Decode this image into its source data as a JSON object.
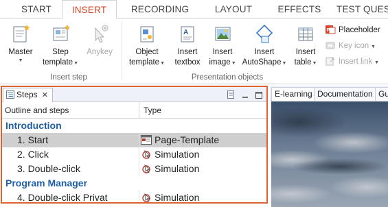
{
  "tabs": [
    {
      "label": "START",
      "active": false
    },
    {
      "label": "INSERT",
      "active": true
    },
    {
      "label": "RECORDING",
      "active": false
    },
    {
      "label": "LAYOUT",
      "active": false
    },
    {
      "label": "EFFECTS",
      "active": false
    },
    {
      "label": "TEST QUES",
      "active": false
    }
  ],
  "ribbon": {
    "insert_step_group": {
      "label": "Insert step",
      "master": {
        "line1": "Master",
        "line2": ""
      },
      "step_template": {
        "line1": "Step",
        "line2": "template"
      },
      "anykey": {
        "line1": "Anykey"
      }
    },
    "presentation_group": {
      "label": "Presentation objects",
      "object_template": {
        "line1": "Object",
        "line2": "template"
      },
      "insert_textbox": {
        "line1": "Insert",
        "line2": "textbox"
      },
      "insert_image": {
        "line1": "Insert",
        "line2": "image"
      },
      "insert_autoshape": {
        "line1": "Insert",
        "line2": "AutoShape"
      },
      "insert_table": {
        "line1": "Insert",
        "line2": "table"
      },
      "placeholder": "Placeholder",
      "key_icon": "Key icon",
      "insert_link": "Insert link"
    }
  },
  "steps_panel": {
    "tab_label": "Steps",
    "columns": {
      "outline": "Outline and steps",
      "type": "Type"
    },
    "rows": [
      {
        "kind": "section",
        "name": "Introduction",
        "type": ""
      },
      {
        "kind": "step",
        "name": "1. Start",
        "type": "Page-Template",
        "icon": "page-template-icon",
        "selected": true
      },
      {
        "kind": "step",
        "name": "2. Click",
        "type": "Simulation",
        "icon": "simulation-icon",
        "selected": false
      },
      {
        "kind": "step",
        "name": "3. Double-click",
        "type": "Simulation",
        "icon": "simulation-icon",
        "selected": false
      },
      {
        "kind": "section",
        "name": "Program Manager",
        "type": ""
      },
      {
        "kind": "step",
        "name": "4. Double-click Privat",
        "type": "Simulation",
        "icon": "simulation-icon",
        "selected": false
      }
    ]
  },
  "preview": {
    "tabs": [
      {
        "label": "E-learning",
        "active": true
      },
      {
        "label": "Documentation",
        "active": false
      },
      {
        "label": "Gu",
        "active": false
      }
    ]
  },
  "colors": {
    "accent": "#d24726",
    "panel_border": "#e0622f",
    "section_text": "#1f5fa8",
    "selected_row": "#cfcfcf"
  }
}
